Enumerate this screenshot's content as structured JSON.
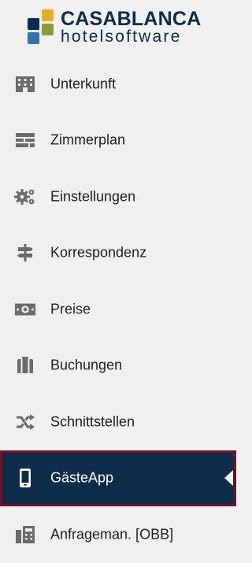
{
  "brand": {
    "name": "CASABLANCA",
    "subtitle": "hotelsoftware",
    "colors": {
      "navy": "#0b2d4d",
      "gold": "#e6b01e",
      "blue": "#2a6ea6",
      "olive": "#8a9a3a",
      "accent_square": "#2d74b0"
    }
  },
  "theme": {
    "sidebar_bg": "#f0f0f0",
    "text": "#1f1f1f",
    "icon": "#6b6b6b",
    "active_bg": "#0d2d4b",
    "active_border": "#7a0f24",
    "active_text": "#ffffff"
  },
  "menu": {
    "items": [
      {
        "label": "Unterkunft",
        "icon": "building-icon"
      },
      {
        "label": "Zimmerplan",
        "icon": "room-plan-icon"
      },
      {
        "label": "Einstellungen",
        "icon": "settings-gears-icon"
      },
      {
        "label": "Korrespondenz",
        "icon": "signpost-icon"
      },
      {
        "label": "Preise",
        "icon": "money-icon"
      },
      {
        "label": "Buchungen",
        "icon": "luggage-icon"
      },
      {
        "label": "Schnittstellen",
        "icon": "shuffle-icon"
      },
      {
        "label": "GästeApp",
        "icon": "smartphone-icon",
        "active": true
      },
      {
        "label": "Anfrageman. [OBB]",
        "icon": "calculator-building-icon"
      }
    ]
  }
}
